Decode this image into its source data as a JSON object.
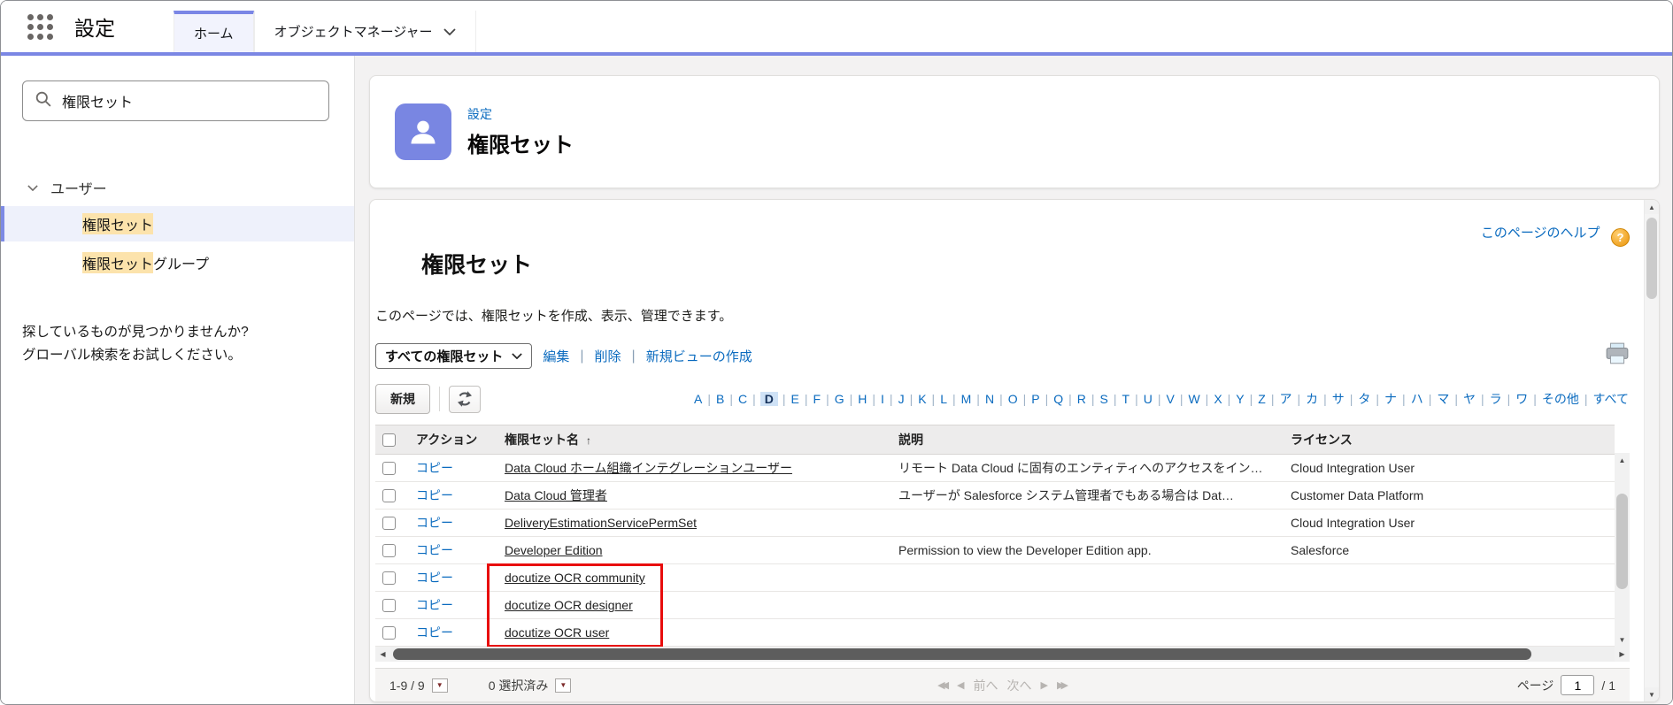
{
  "header": {
    "app_label": "設定",
    "tabs": [
      {
        "label": "ホーム",
        "active": true
      },
      {
        "label": "オブジェクトマネージャー",
        "active": false
      }
    ]
  },
  "sidebar": {
    "search": {
      "value": "権限セット"
    },
    "tree": {
      "section_label": "ユーザー",
      "items": [
        {
          "highlight": "権限セット",
          "rest": "",
          "selected": true
        },
        {
          "highlight": "権限セット",
          "rest": "グループ",
          "selected": false
        }
      ]
    },
    "not_found_line1": "探しているものが見つかりませんか?",
    "not_found_line2": "グローバル検索をお試しください。"
  },
  "page_header": {
    "breadcrumb": "設定",
    "title": "権限セット"
  },
  "content": {
    "help_link": "このページのヘルプ",
    "title": "権限セット",
    "description": "このページでは、権限セットを作成、表示、管理できます。",
    "view_select": "すべての権限セット",
    "view_links": [
      "編集",
      "削除",
      "新規ビューの作成"
    ],
    "new_button": "新規",
    "alphabet": [
      "A",
      "B",
      "C",
      "D",
      "E",
      "F",
      "G",
      "H",
      "I",
      "J",
      "K",
      "L",
      "M",
      "N",
      "O",
      "P",
      "Q",
      "R",
      "S",
      "T",
      "U",
      "V",
      "W",
      "X",
      "Y",
      "Z",
      "ア",
      "カ",
      "サ",
      "タ",
      "ナ",
      "ハ",
      "マ",
      "ヤ",
      "ラ",
      "ワ",
      "その他",
      "すべて"
    ],
    "alphabet_selected": "D",
    "table": {
      "columns": [
        "アクション",
        "権限セット名",
        "説明",
        "ライセンス"
      ],
      "sort_column": "権限セット名",
      "rows": [
        {
          "action": "コピー",
          "name": "Data Cloud ホーム組織インテグレーションユーザー",
          "description": "リモート Data Cloud に固有のエンティティへのアクセスをイン…",
          "license": "Cloud Integration User",
          "boxed": false
        },
        {
          "action": "コピー",
          "name": "Data Cloud 管理者",
          "description": "ユーザーが Salesforce システム管理者でもある場合は Dat…",
          "license": "Customer Data Platform",
          "boxed": false
        },
        {
          "action": "コピー",
          "name": "DeliveryEstimationServicePermSet",
          "description": "",
          "license": "Cloud Integration User",
          "boxed": false
        },
        {
          "action": "コピー",
          "name": "Developer Edition",
          "description": "Permission to view the Developer Edition app.",
          "license": "Salesforce",
          "boxed": false
        },
        {
          "action": "コピー",
          "name": "docutize OCR community",
          "description": "",
          "license": "",
          "boxed": true
        },
        {
          "action": "コピー",
          "name": "docutize OCR designer",
          "description": "",
          "license": "",
          "boxed": true
        },
        {
          "action": "コピー",
          "name": "docutize OCR user",
          "description": "",
          "license": "",
          "boxed": true
        }
      ]
    },
    "footer": {
      "range": "1-9 / 9",
      "selected_count": "0 選択済み",
      "prev": "前へ",
      "next": "次へ",
      "page_label": "ページ",
      "page_value": "1",
      "page_total": "/ 1"
    }
  },
  "icons": {
    "up": "▲",
    "down": "▼",
    "left": "◀",
    "right": "▶",
    "sort_asc": "↑",
    "dropdown": "▼",
    "question_mark": "?"
  },
  "colors": {
    "accent": "#7b87e4",
    "link": "#0b6bbf",
    "search_highlight": "#fce3ac",
    "red_box": "#e80c0c",
    "help_icon": "#ea9309"
  }
}
